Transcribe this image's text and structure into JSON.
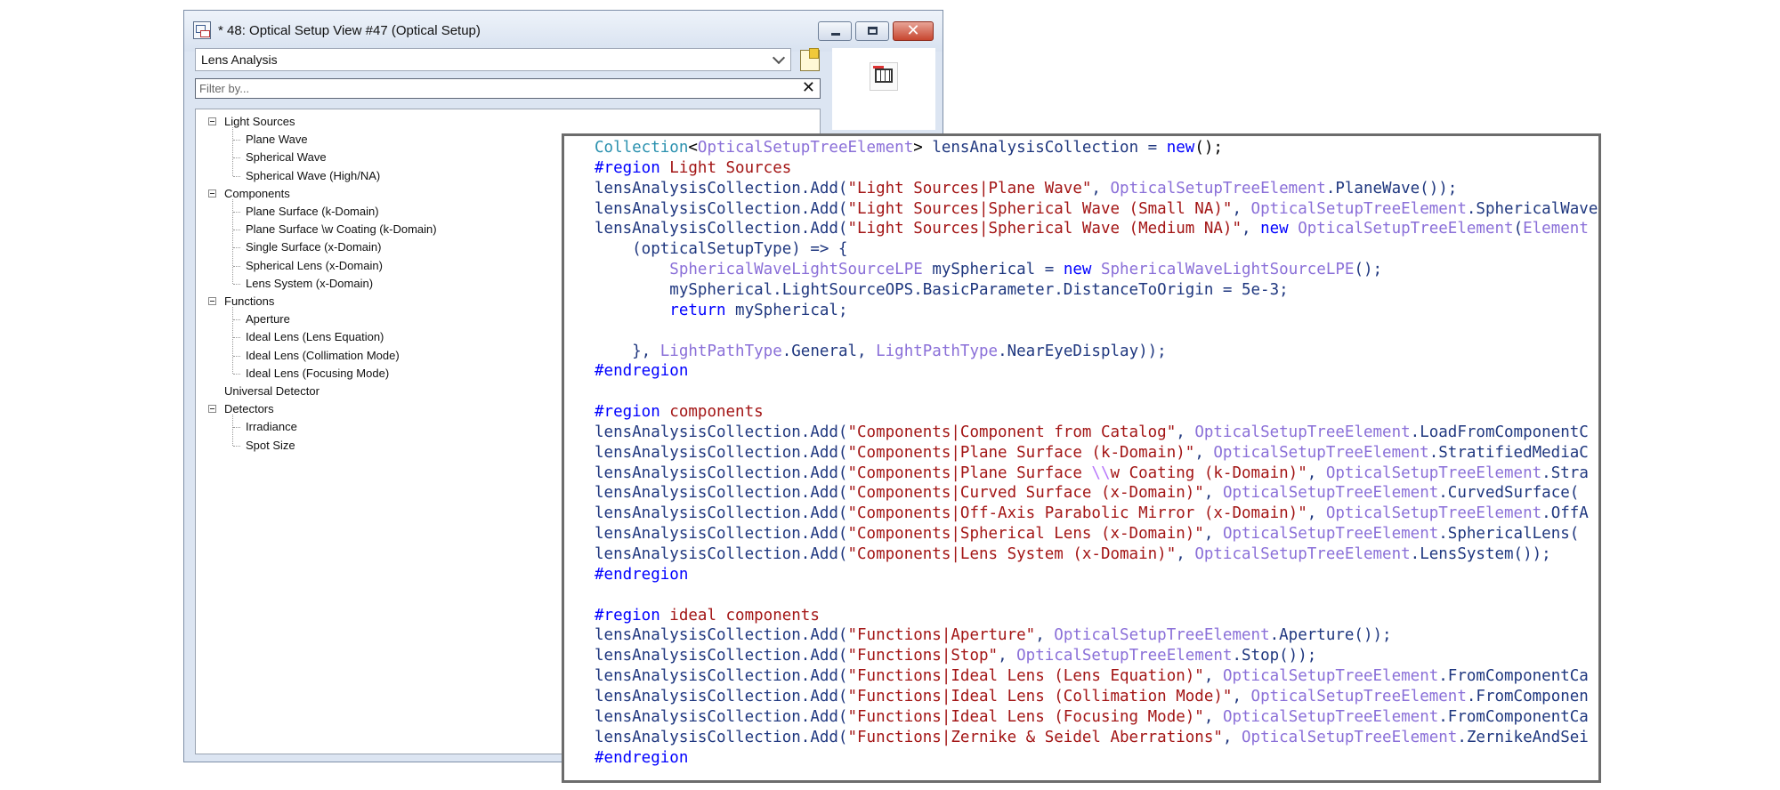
{
  "window": {
    "title": "* 48: Optical Setup View #47 (Optical Setup)",
    "dropdown_value": "Lens Analysis",
    "filter_placeholder": "Filter by...",
    "clear_glyph": "✕",
    "close_glyph": "✕"
  },
  "tree": {
    "groups": [
      {
        "label": "Light Sources",
        "items": [
          "Plane Wave",
          "Spherical Wave",
          "Spherical Wave (High/NA)"
        ]
      },
      {
        "label": "Components",
        "items": [
          "Plane Surface (k-Domain)",
          "Plane Surface \\w Coating (k-Domain)",
          "Single Surface (x-Domain)",
          "Spherical Lens (x-Domain)",
          "Lens System (x-Domain)"
        ]
      },
      {
        "label": "Functions",
        "items": [
          "Aperture",
          "Ideal Lens (Lens Equation)",
          "Ideal Lens (Collimation Mode)",
          "Ideal Lens (Focusing Mode)"
        ]
      },
      {
        "label": "Universal Detector",
        "items": []
      },
      {
        "label": "Detectors",
        "items": [
          "Irradiance",
          "Spot Size"
        ]
      }
    ]
  },
  "icons": {
    "window": "optical-setup-window-icon",
    "note": "new-note-icon",
    "chart": "lens-analysis-chart-icon",
    "dropdown": "chevron-down-icon",
    "clear": "close-icon"
  },
  "code": {
    "lines": [
      [
        [
          "type",
          "Collection"
        ],
        [
          "plain",
          "<"
        ],
        [
          "cls",
          "OpticalSetupTreeElement"
        ],
        [
          "plain",
          "> "
        ],
        [
          "ident",
          "lensAnalysisCollection = "
        ],
        [
          "kw",
          "new"
        ],
        [
          "plain",
          "();"
        ]
      ],
      [
        [
          "kw",
          "#region"
        ],
        [
          "str",
          " Light Sources"
        ]
      ],
      [
        [
          "ident",
          "lensAnalysisCollection.Add("
        ],
        [
          "str",
          "\"Light Sources|Plane Wave\""
        ],
        [
          "ident",
          ", "
        ],
        [
          "cls",
          "OpticalSetupTreeElement"
        ],
        [
          "ident",
          ".PlaneWave());"
        ]
      ],
      [
        [
          "ident",
          "lensAnalysisCollection.Add("
        ],
        [
          "str",
          "\"Light Sources|Spherical Wave (Small NA)\""
        ],
        [
          "ident",
          ", "
        ],
        [
          "cls",
          "OpticalSetupTreeElement"
        ],
        [
          "ident",
          ".SphericalWave"
        ]
      ],
      [
        [
          "ident",
          "lensAnalysisCollection.Add("
        ],
        [
          "str",
          "\"Light Sources|Spherical Wave (Medium NA)\""
        ],
        [
          "ident",
          ", "
        ],
        [
          "kw",
          "new "
        ],
        [
          "cls",
          "OpticalSetupTreeElement"
        ],
        [
          "ident",
          "("
        ],
        [
          "cls",
          "Element"
        ]
      ],
      [
        [
          "ident",
          "    (opticalSetupType) => {"
        ]
      ],
      [
        [
          "ident",
          "        "
        ],
        [
          "cls",
          "SphericalWaveLightSourceLPE"
        ],
        [
          "ident",
          " mySpherical = "
        ],
        [
          "kw",
          "new "
        ],
        [
          "cls",
          "SphericalWaveLightSourceLPE"
        ],
        [
          "ident",
          "();"
        ]
      ],
      [
        [
          "ident",
          "        mySpherical.LightSourceOPS.BasicParameter.DistanceToOrigin = 5e-3;"
        ]
      ],
      [
        [
          "ident",
          "        "
        ],
        [
          "kw",
          "return"
        ],
        [
          "ident",
          " mySpherical;"
        ]
      ],
      [
        [
          "ident",
          ""
        ]
      ],
      [
        [
          "ident",
          "    }, "
        ],
        [
          "cls",
          "LightPathType"
        ],
        [
          "ident",
          ".General, "
        ],
        [
          "cls",
          "LightPathType"
        ],
        [
          "ident",
          ".NearEyeDisplay));"
        ]
      ],
      [
        [
          "kw",
          "#endregion"
        ]
      ],
      [
        [
          "ident",
          ""
        ]
      ],
      [
        [
          "kw",
          "#region"
        ],
        [
          "str",
          " components"
        ]
      ],
      [
        [
          "ident",
          "lensAnalysisCollection.Add("
        ],
        [
          "str",
          "\"Components|Component from Catalog\""
        ],
        [
          "ident",
          ", "
        ],
        [
          "cls",
          "OpticalSetupTreeElement"
        ],
        [
          "ident",
          ".LoadFromComponentC"
        ]
      ],
      [
        [
          "ident",
          "lensAnalysisCollection.Add("
        ],
        [
          "str",
          "\"Components|Plane Surface (k-Domain)\""
        ],
        [
          "ident",
          ", "
        ],
        [
          "cls",
          "OpticalSetupTreeElement"
        ],
        [
          "ident",
          ".StratifiedMediaC"
        ]
      ],
      [
        [
          "ident",
          "lensAnalysisCollection.Add("
        ],
        [
          "str",
          "\"Components|Plane Surface "
        ],
        [
          "esc",
          "\\\\"
        ],
        [
          "str",
          "w Coating (k-Domain)\""
        ],
        [
          "ident",
          ", "
        ],
        [
          "cls",
          "OpticalSetupTreeElement"
        ],
        [
          "ident",
          ".Stra"
        ]
      ],
      [
        [
          "ident",
          "lensAnalysisCollection.Add("
        ],
        [
          "str",
          "\"Components|Curved Surface (x-Domain)\""
        ],
        [
          "ident",
          ", "
        ],
        [
          "cls",
          "OpticalSetupTreeElement"
        ],
        [
          "ident",
          ".CurvedSurface("
        ]
      ],
      [
        [
          "ident",
          "lensAnalysisCollection.Add("
        ],
        [
          "str",
          "\"Components|Off-Axis Parabolic Mirror (x-Domain)\""
        ],
        [
          "ident",
          ", "
        ],
        [
          "cls",
          "OpticalSetupTreeElement"
        ],
        [
          "ident",
          ".OffA"
        ]
      ],
      [
        [
          "ident",
          "lensAnalysisCollection.Add("
        ],
        [
          "str",
          "\"Components|Spherical Lens (x-Domain)\""
        ],
        [
          "ident",
          ", "
        ],
        [
          "cls",
          "OpticalSetupTreeElement"
        ],
        [
          "ident",
          ".SphericalLens("
        ]
      ],
      [
        [
          "ident",
          "lensAnalysisCollection.Add("
        ],
        [
          "str",
          "\"Components|Lens System (x-Domain)\""
        ],
        [
          "ident",
          ", "
        ],
        [
          "cls",
          "OpticalSetupTreeElement"
        ],
        [
          "ident",
          ".LensSystem());"
        ]
      ],
      [
        [
          "kw",
          "#endregion"
        ]
      ],
      [
        [
          "ident",
          ""
        ]
      ],
      [
        [
          "kw",
          "#region"
        ],
        [
          "str",
          " ideal components"
        ]
      ],
      [
        [
          "ident",
          "lensAnalysisCollection.Add("
        ],
        [
          "str",
          "\"Functions|Aperture\""
        ],
        [
          "ident",
          ", "
        ],
        [
          "cls",
          "OpticalSetupTreeElement"
        ],
        [
          "ident",
          ".Aperture());"
        ]
      ],
      [
        [
          "ident",
          "lensAnalysisCollection.Add("
        ],
        [
          "str",
          "\"Functions|Stop\""
        ],
        [
          "ident",
          ", "
        ],
        [
          "cls",
          "OpticalSetupTreeElement"
        ],
        [
          "ident",
          ".Stop());"
        ]
      ],
      [
        [
          "ident",
          "lensAnalysisCollection.Add("
        ],
        [
          "str",
          "\"Functions|Ideal Lens (Lens Equation)\""
        ],
        [
          "ident",
          ", "
        ],
        [
          "cls",
          "OpticalSetupTreeElement"
        ],
        [
          "ident",
          ".FromComponentCa"
        ]
      ],
      [
        [
          "ident",
          "lensAnalysisCollection.Add("
        ],
        [
          "str",
          "\"Functions|Ideal Lens (Collimation Mode)\""
        ],
        [
          "ident",
          ", "
        ],
        [
          "cls",
          "OpticalSetupTreeElement"
        ],
        [
          "ident",
          ".FromComponen"
        ]
      ],
      [
        [
          "ident",
          "lensAnalysisCollection.Add("
        ],
        [
          "str",
          "\"Functions|Ideal Lens (Focusing Mode)\""
        ],
        [
          "ident",
          ", "
        ],
        [
          "cls",
          "OpticalSetupTreeElement"
        ],
        [
          "ident",
          ".FromComponentCa"
        ]
      ],
      [
        [
          "ident",
          "lensAnalysisCollection.Add("
        ],
        [
          "str",
          "\"Functions|Zernike & Seidel Aberrations\""
        ],
        [
          "ident",
          ", "
        ],
        [
          "cls",
          "OpticalSetupTreeElement"
        ],
        [
          "ident",
          ".ZernikeAndSei"
        ]
      ],
      [
        [
          "kw",
          "#endregion"
        ]
      ]
    ]
  }
}
